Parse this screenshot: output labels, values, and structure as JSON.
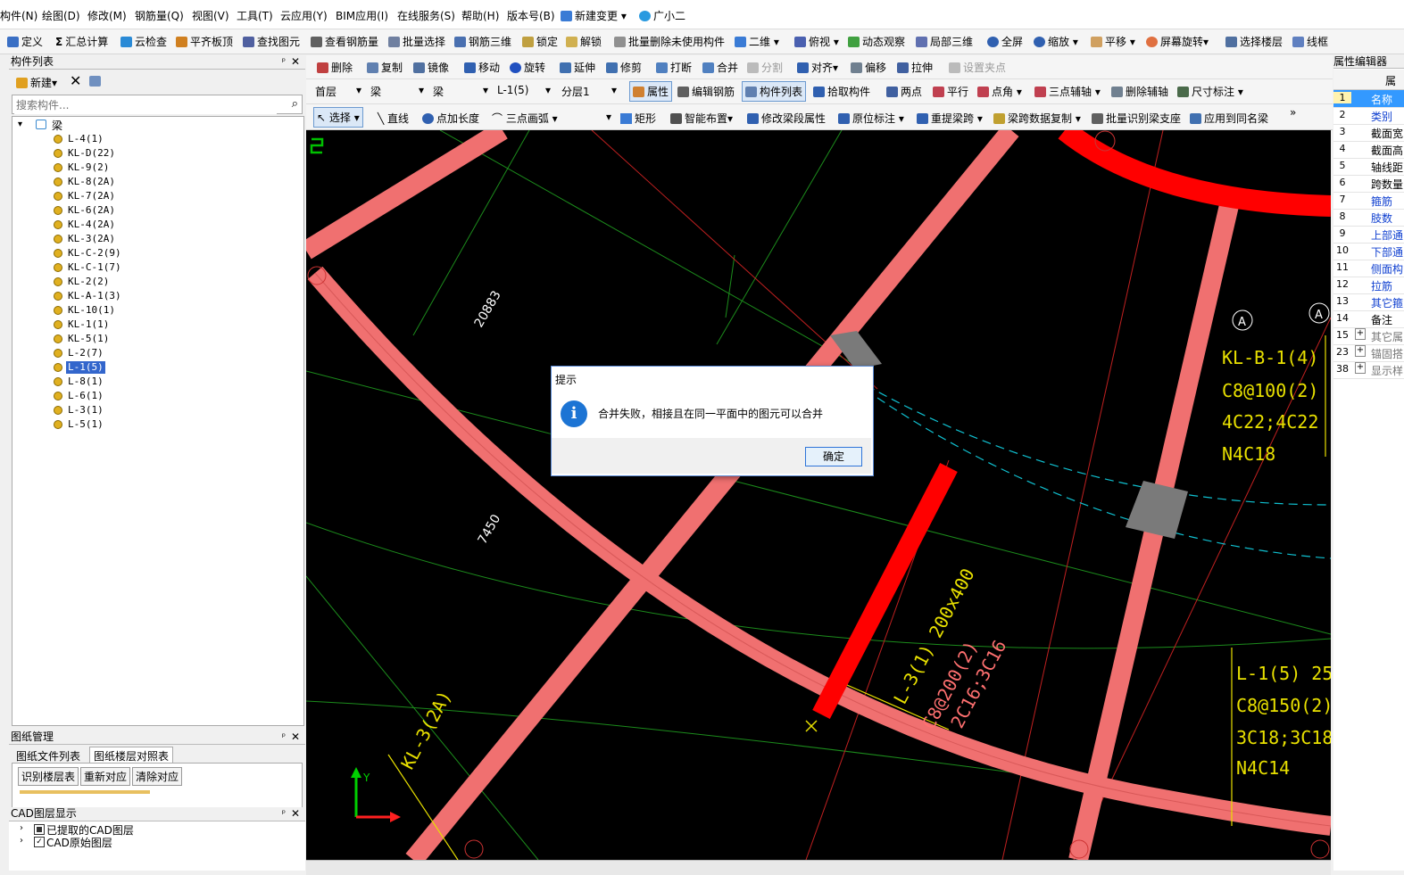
{
  "menu": [
    "构件(N)",
    "绘图(D)",
    "修改(M)",
    "钢筋量(Q)",
    "视图(V)",
    "工具(T)",
    "云应用(Y)",
    "BIM应用(I)",
    "在线服务(S)",
    "帮助(H)",
    "版本号(B)",
    "新建变更",
    "广小二"
  ],
  "toolbar1": [
    "定义",
    "汇总计算",
    "云检查",
    "平齐板顶",
    "查找图元",
    "查看钢筋量",
    "批量选择",
    "钢筋三维",
    "锁定",
    "解锁",
    "批量删除未使用构件",
    "二维",
    "俯视",
    "动态观察",
    "局部三维",
    "全屏",
    "缩放",
    "平移",
    "屏幕旋转",
    "选择楼层",
    "线框"
  ],
  "toolbar2": [
    "删除",
    "复制",
    "镜像",
    "移动",
    "旋转",
    "延伸",
    "修剪",
    "打断",
    "合并",
    "分割",
    "对齐",
    "偏移",
    "拉伸",
    "设置夹点"
  ],
  "toolbar3": {
    "floor": "首层",
    "type1": "梁",
    "type2": "梁",
    "component": "L-1(5)",
    "layer": "分层1",
    "buttons": [
      "属性",
      "编辑钢筋",
      "构件列表",
      "拾取构件",
      "两点",
      "平行",
      "点角",
      "三点辅轴",
      "删除辅轴",
      "尺寸标注"
    ]
  },
  "toolbar4": [
    "选择",
    "直线",
    "点加长度",
    "三点画弧",
    "矩形",
    "智能布置",
    "修改梁段属性",
    "原位标注",
    "重提梁跨",
    "梁跨数据复制",
    "批量识别梁支座",
    "应用到同名梁"
  ],
  "component_panel": {
    "title": "构件列表",
    "new_label": "新建",
    "search_placeholder": "搜索构件...",
    "root": "梁",
    "items": [
      "L-4(1)",
      "KL-D(22)",
      "KL-9(2)",
      "KL-8(2A)",
      "KL-7(2A)",
      "KL-6(2A)",
      "KL-4(2A)",
      "KL-3(2A)",
      "KL-C-2(9)",
      "KL-C-1(7)",
      "KL-2(2)",
      "KL-A-1(3)",
      "KL-10(1)",
      "KL-1(1)",
      "KL-5(1)",
      "L-2(7)",
      "L-1(5)",
      "L-8(1)",
      "L-6(1)",
      "L-3(1)",
      "L-5(1)"
    ],
    "selected": "L-1(5)"
  },
  "drawing_panel": {
    "title": "图纸管理",
    "tabs": [
      "图纸文件列表",
      "图纸楼层对照表"
    ],
    "buttons": [
      "识别楼层表",
      "重新对应",
      "清除对应"
    ]
  },
  "cad_panel": {
    "title": "CAD图层显示",
    "layers": [
      "已提取的CAD图层",
      "CAD原始图层"
    ]
  },
  "property_panel": {
    "title": "属性编辑器",
    "header": "属",
    "rows": [
      {
        "n": "1",
        "v": "名称",
        "blue": true
      },
      {
        "n": "2",
        "v": "类别",
        "blue": true
      },
      {
        "n": "3",
        "v": "截面宽",
        "blue": false
      },
      {
        "n": "4",
        "v": "截面高",
        "blue": false
      },
      {
        "n": "5",
        "v": "轴线距",
        "blue": false
      },
      {
        "n": "6",
        "v": "跨数量",
        "blue": false
      },
      {
        "n": "7",
        "v": "箍筋",
        "blue": true
      },
      {
        "n": "8",
        "v": "肢数",
        "blue": true
      },
      {
        "n": "9",
        "v": "上部通",
        "blue": true
      },
      {
        "n": "10",
        "v": "下部通",
        "blue": true
      },
      {
        "n": "11",
        "v": "侧面构",
        "blue": true
      },
      {
        "n": "12",
        "v": "拉筋",
        "blue": true
      },
      {
        "n": "13",
        "v": "其它箍",
        "blue": true
      },
      {
        "n": "14",
        "v": "备注",
        "blue": false
      },
      {
        "n": "15",
        "v": "其它属",
        "blue": false
      },
      {
        "n": "23",
        "v": "锚固搭",
        "blue": false
      },
      {
        "n": "38",
        "v": "显示样",
        "blue": false
      }
    ]
  },
  "canvas_labels": {
    "dim1": "20883",
    "dim2": "7450",
    "kl3": "KL-3(2A)",
    "l3_a": "L-3(1)  200x400",
    "l3_b": "C8@200(2)",
    "l3_c": "2C16;3C16",
    "klb_a": "KL-B-1(4)",
    "klb_b": "C8@100(2)",
    "klb_c": "4C22;4C22",
    "klb_d": "N4C18",
    "l1_a": "L-1(5)  25",
    "l1_b": "C8@150(2)",
    "l1_c": "3C18;3C18",
    "l1_d": "N4C14",
    "axis_a1": "A",
    "axis_a2": "A",
    "axis_y": "Y"
  },
  "dialog": {
    "title": "提示",
    "message": "合并失败，相接且在同一平面中的图元可以合并",
    "ok": "确定"
  },
  "colors": {
    "beam": "#f07070",
    "beam_selected": "#ff0000",
    "grid_green": "#1c8c1c",
    "annotation": "#e8e000",
    "canvas": "#000000"
  }
}
